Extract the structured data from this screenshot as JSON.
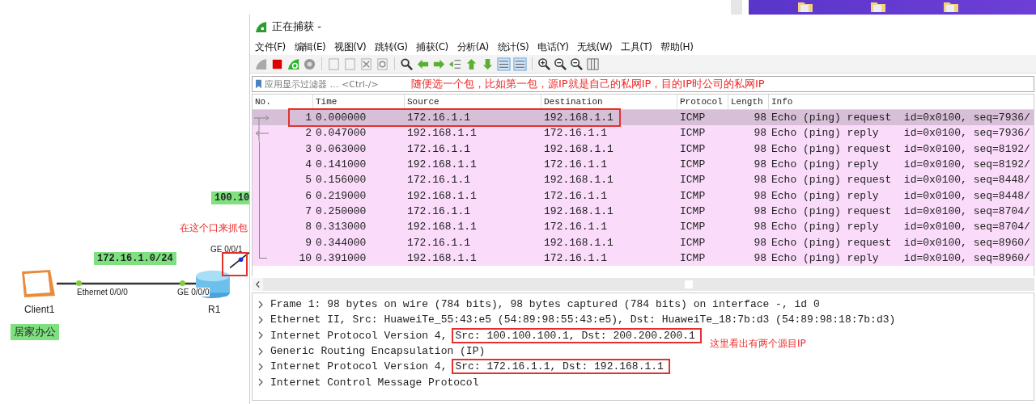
{
  "topology": {
    "wan_label": "100.10",
    "capture_note": "在这个口来抓包",
    "router_wan_port": "GE 0/0/1",
    "subnet_label": "172.16.1.0/24",
    "client_port": "Ethernet 0/0/0",
    "router_lan_port": "GE 0/0/0",
    "client_name": "Client1",
    "router_name": "R1",
    "site_label": "居家办公"
  },
  "window": {
    "title": "正在捕获 -"
  },
  "menu": [
    "文件(F)",
    "编辑(E)",
    "视图(V)",
    "跳转(G)",
    "捕获(C)",
    "分析(A)",
    "统计(S)",
    "电话(Y)",
    "无线(W)",
    "工具(T)",
    "帮助(H)"
  ],
  "filter": {
    "placeholder": "应用显示过滤器 … <Ctrl-/>",
    "note": "随便选一个包，比如第一包，源IP就是自己的私网IP，目的IP时公司的私网IP"
  },
  "packet_list": {
    "columns": [
      "No.",
      "Time",
      "Source",
      "Destination",
      "Protocol",
      "Length",
      "Info"
    ],
    "rows": [
      {
        "no": "1",
        "time": "0.000000",
        "source": "172.16.1.1",
        "destination": "192.168.1.1",
        "protocol": "ICMP",
        "length": "98",
        "info": "Echo (ping) request  id=0x0100, seq=7936/",
        "selected": true
      },
      {
        "no": "2",
        "time": "0.047000",
        "source": "192.168.1.1",
        "destination": "172.16.1.1",
        "protocol": "ICMP",
        "length": "98",
        "info": "Echo (ping) reply    id=0x0100, seq=7936/",
        "selected": false
      },
      {
        "no": "3",
        "time": "0.063000",
        "source": "172.16.1.1",
        "destination": "192.168.1.1",
        "protocol": "ICMP",
        "length": "98",
        "info": "Echo (ping) request  id=0x0100, seq=8192/",
        "selected": false
      },
      {
        "no": "4",
        "time": "0.141000",
        "source": "192.168.1.1",
        "destination": "172.16.1.1",
        "protocol": "ICMP",
        "length": "98",
        "info": "Echo (ping) reply    id=0x0100, seq=8192/",
        "selected": false
      },
      {
        "no": "5",
        "time": "0.156000",
        "source": "172.16.1.1",
        "destination": "192.168.1.1",
        "protocol": "ICMP",
        "length": "98",
        "info": "Echo (ping) request  id=0x0100, seq=8448/",
        "selected": false
      },
      {
        "no": "6",
        "time": "0.219000",
        "source": "192.168.1.1",
        "destination": "172.16.1.1",
        "protocol": "ICMP",
        "length": "98",
        "info": "Echo (ping) reply    id=0x0100, seq=8448/",
        "selected": false
      },
      {
        "no": "7",
        "time": "0.250000",
        "source": "172.16.1.1",
        "destination": "192.168.1.1",
        "protocol": "ICMP",
        "length": "98",
        "info": "Echo (ping) request  id=0x0100, seq=8704/",
        "selected": false
      },
      {
        "no": "8",
        "time": "0.313000",
        "source": "192.168.1.1",
        "destination": "172.16.1.1",
        "protocol": "ICMP",
        "length": "98",
        "info": "Echo (ping) reply    id=0x0100, seq=8704/",
        "selected": false
      },
      {
        "no": "9",
        "time": "0.344000",
        "source": "172.16.1.1",
        "destination": "192.168.1.1",
        "protocol": "ICMP",
        "length": "98",
        "info": "Echo (ping) request  id=0x0100, seq=8960/",
        "selected": false
      },
      {
        "no": "10",
        "time": "0.391000",
        "source": "192.168.1.1",
        "destination": "172.16.1.1",
        "protocol": "ICMP",
        "length": "98",
        "info": "Echo (ping) reply    id=0x0100, seq=8960/",
        "selected": false
      }
    ]
  },
  "details": [
    {
      "text": "Frame 1: 98 bytes on wire (784 bits), 98 bytes captured (784 bits) on interface -, id 0",
      "expanded": false
    },
    {
      "text": "Ethernet II, Src: HuaweiTe_55:43:e5 (54:89:98:55:43:e5), Dst: HuaweiTe_18:7b:d3 (54:89:98:18:7b:d3)",
      "expanded": false
    },
    {
      "text": "Internet Protocol Version 4,",
      "boxed": "Src: 100.100.100.1, Dst: 200.200.200.1",
      "expanded": false
    },
    {
      "text": "Generic Routing Encapsulation (IP)",
      "expanded": false
    },
    {
      "text": "Internet Protocol Version 4,",
      "boxed": "Src: 172.16.1.1, Dst: 192.168.1.1",
      "expanded": false
    },
    {
      "text": "Internet Control Message Protocol",
      "expanded": false
    }
  ],
  "details_note": "这里看出有两个源目IP"
}
